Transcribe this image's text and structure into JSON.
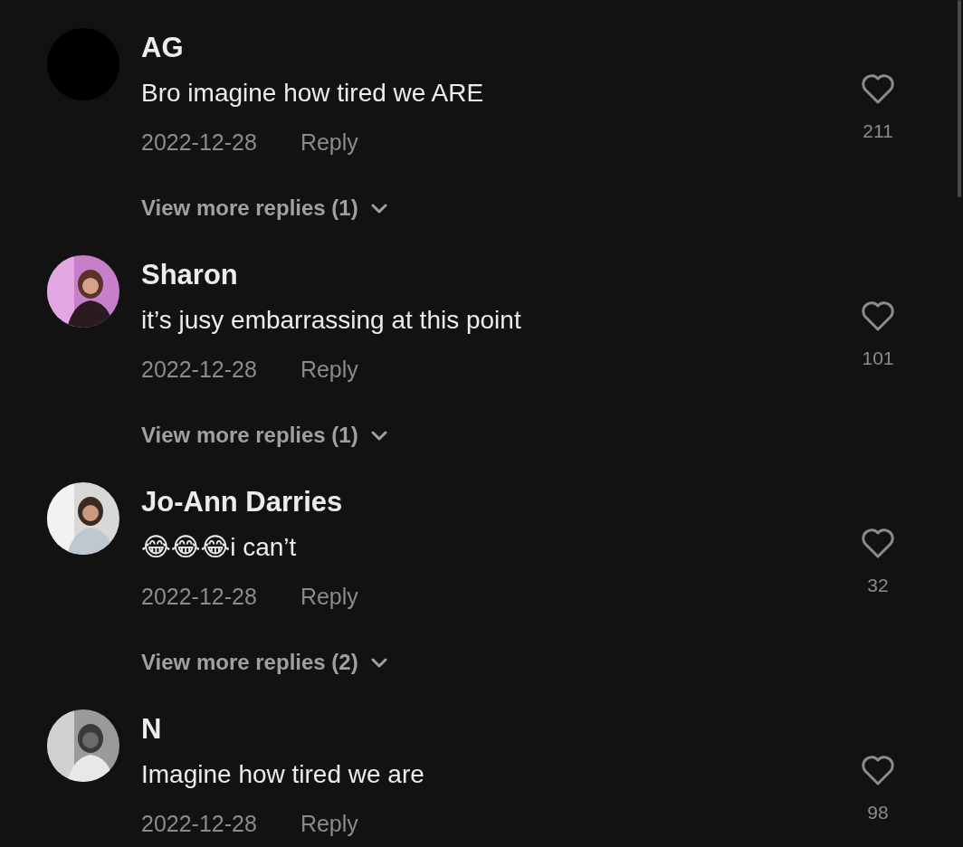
{
  "comments": [
    {
      "avatar": {
        "kind": "plain"
      },
      "name": "AG",
      "text": "Bro imagine how tired we ARE",
      "date": "2022-12-28",
      "reply": "Reply",
      "likes": "211",
      "view_replies": "View more replies (1)"
    },
    {
      "name": "Sharon",
      "text": "it’s jusy embarrassing at this point",
      "date": "2022-12-28",
      "reply": "Reply",
      "likes": "101",
      "view_replies": "View more replies (1)"
    },
    {
      "name": "Jo-Ann Darries",
      "text": "😂😂😂i can’t",
      "date": "2022-12-28",
      "reply": "Reply",
      "likes": "32",
      "view_replies": "View more replies (2)"
    },
    {
      "name": "N",
      "text": "Imagine how tired we are",
      "date": "2022-12-28",
      "reply": "Reply",
      "likes": "98"
    }
  ]
}
